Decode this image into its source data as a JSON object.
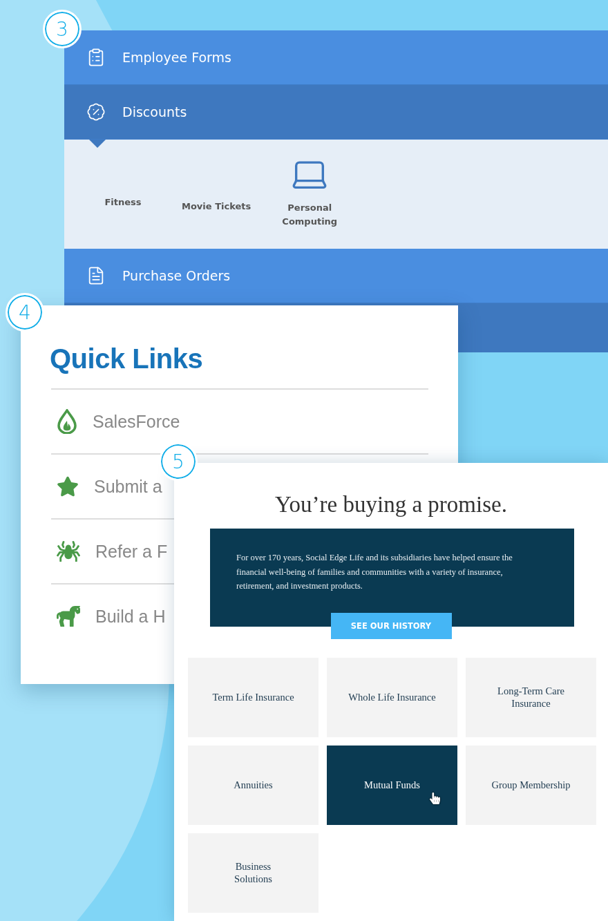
{
  "accordion": {
    "badge": "3",
    "items": [
      {
        "label": "Employee Forms",
        "expanded": false
      },
      {
        "label": "Discounts",
        "expanded": true,
        "options": [
          "Fitness",
          "Movie Tickets",
          "Personal\nComputing"
        ]
      },
      {
        "label": "Purchase Orders",
        "expanded": false
      }
    ]
  },
  "quick_links": {
    "badge": "4",
    "title": "Quick Links",
    "links": [
      "SalesForce",
      "Submit a",
      "Refer a F",
      "Build a H"
    ]
  },
  "promise": {
    "badge": "5",
    "title": "You’re buying a promise.",
    "body": "For over 170 years, Social Edge Life and its subsidiaries have helped ensure the financial well-being of families and communities with a variety of insurance, retirement, and investment products.",
    "button": "SEE OUR HISTORY",
    "tiles": [
      {
        "label": "Term Life Insurance",
        "selected": false
      },
      {
        "label": "Whole Life Insurance",
        "selected": false
      },
      {
        "label": "Long-Term Care\nInsurance",
        "selected": false
      },
      {
        "label": "Annuities",
        "selected": false
      },
      {
        "label": "Mutual Funds",
        "selected": true
      },
      {
        "label": "Group Membership",
        "selected": false
      },
      {
        "label": "Business\nSolutions",
        "selected": false
      }
    ]
  }
}
